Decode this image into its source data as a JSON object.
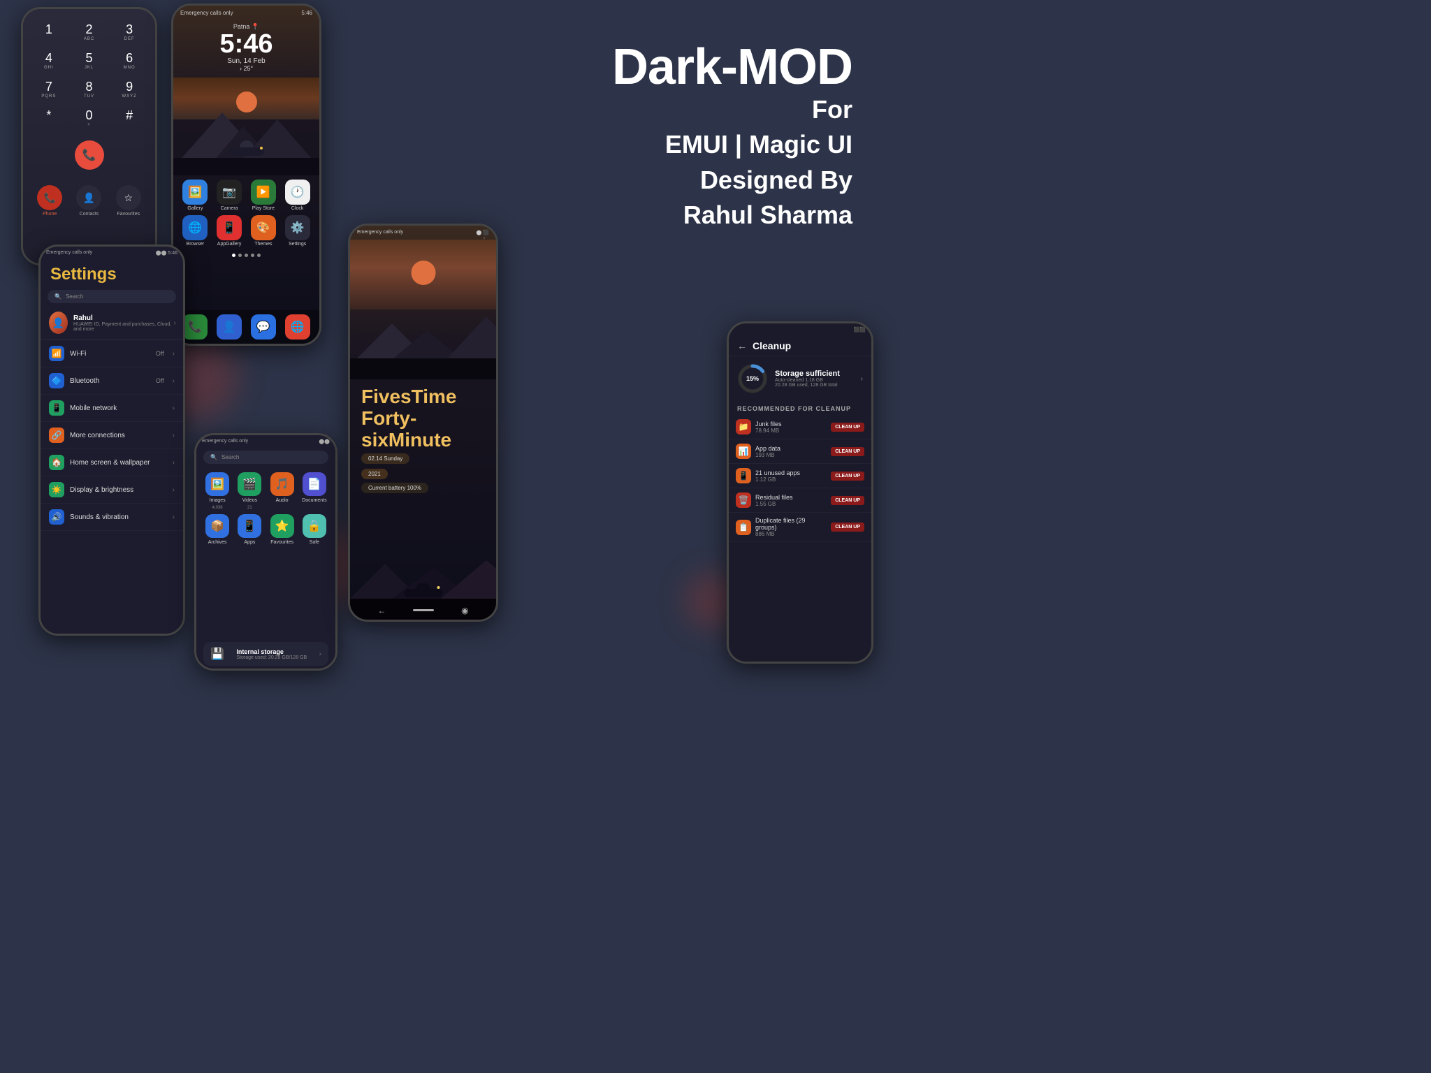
{
  "branding": {
    "title": "Dark-MOD",
    "line1": "For",
    "line2": "EMUI | Magic UI",
    "line3": "Designed By",
    "line4": "Rahul Sharma"
  },
  "phone_dialer": {
    "keys": [
      {
        "num": "1",
        "letters": ""
      },
      {
        "num": "2",
        "letters": "ABC"
      },
      {
        "num": "3",
        "letters": "DEF"
      },
      {
        "num": "4",
        "letters": "GHI"
      },
      {
        "num": "5",
        "letters": "JKL"
      },
      {
        "num": "6",
        "letters": "MNO"
      },
      {
        "num": "7",
        "letters": "PQRS"
      },
      {
        "num": "8",
        "letters": "TUV"
      },
      {
        "num": "9",
        "letters": "WXYZ"
      },
      {
        "num": "*",
        "letters": ""
      },
      {
        "num": "0",
        "letters": "+"
      },
      {
        "num": "#",
        "letters": ""
      }
    ],
    "actions": [
      "Phone",
      "Contacts",
      "Favourites"
    ]
  },
  "phone_home": {
    "status_left": "Emergency calls only",
    "status_right": "5:46",
    "city": "Patna",
    "time": "5:46",
    "date": "Sun, 14 Feb",
    "temp": "25°",
    "apps_row1": [
      {
        "name": "Gallery",
        "color": "#3080e0"
      },
      {
        "name": "Camera",
        "color": "#222"
      },
      {
        "name": "Play Store",
        "color": "#2a7a3a"
      },
      {
        "name": "Clock",
        "color": "#eee"
      }
    ],
    "apps_row2": [
      {
        "name": "Browser",
        "color": "#2060c0"
      },
      {
        "name": "AppGallery",
        "color": "#e03030"
      },
      {
        "name": "Themes",
        "color": "#e06020"
      },
      {
        "name": "Settings",
        "color": "#2a2a3a"
      }
    ],
    "dock": [
      {
        "name": "Phone",
        "color": "#2a8a3a"
      },
      {
        "name": "Contacts",
        "color": "#3060d0"
      },
      {
        "name": "Messages",
        "color": "#2a70e0"
      },
      {
        "name": "Chrome",
        "color": "#e04030"
      }
    ]
  },
  "phone_settings": {
    "title": "Settings",
    "search_placeholder": "Search",
    "profile_name": "Rahul",
    "profile_sub": "HUAWEI ID, Payment and purchases, Cloud, and more",
    "items": [
      {
        "icon": "📶",
        "label": "Wi-Fi",
        "value": "Off",
        "color": "#2060d0"
      },
      {
        "icon": "🔷",
        "label": "Bluetooth",
        "value": "Off",
        "color": "#2060d0"
      },
      {
        "icon": "📱",
        "label": "Mobile network",
        "value": "",
        "color": "#20a060"
      },
      {
        "icon": "🔗",
        "label": "More connections",
        "value": "",
        "color": "#e06020"
      },
      {
        "icon": "🏠",
        "label": "Home screen & wallpaper",
        "value": "",
        "color": "#20a060"
      },
      {
        "icon": "☀️",
        "label": "Display & brightness",
        "value": "",
        "color": "#20a060"
      },
      {
        "icon": "🔊",
        "label": "Sounds & vibration",
        "value": "",
        "color": "#2060d0"
      }
    ]
  },
  "phone_files": {
    "search_placeholder": "Search",
    "categories": [
      {
        "icon": "🖼️",
        "label": "Images",
        "count": "4,038",
        "color": "#3070e0"
      },
      {
        "icon": "🎬",
        "label": "Videos",
        "count": "21",
        "color": "#20a060"
      },
      {
        "icon": "🎵",
        "label": "Audio",
        "count": "",
        "color": "#e06020"
      },
      {
        "icon": "📄",
        "label": "Documents",
        "count": "",
        "color": "#5050d0"
      },
      {
        "icon": "📦",
        "label": "Archives",
        "count": "",
        "color": "#3070e0"
      },
      {
        "icon": "📱",
        "label": "Apps",
        "count": "",
        "color": "#3070e0"
      },
      {
        "icon": "⭐",
        "label": "Favourites",
        "count": "",
        "color": "#20a060"
      },
      {
        "icon": "🔒",
        "label": "Safe",
        "count": "",
        "color": "#50c0b0"
      }
    ],
    "storage_title": "Internal storage",
    "storage_sub": "Storage used: 20.28 GB/128 GB"
  },
  "phone_clock": {
    "status_left": "Emergency calls only",
    "big_text1": "FivesTime",
    "big_text2": "Forty-sixMinute",
    "date_line": "02.14 Sunday",
    "year": "2021",
    "battery": "Current battery 100%"
  },
  "phone_cleanup": {
    "title": "Cleanup",
    "storage_percent": "15%",
    "storage_main": "Storage sufficient",
    "storage_sub": "Auto-cleaned 1.18 GB\n20.28 GB used, 128 GB total",
    "section_title": "RECOMMENDED FOR CLEANUP",
    "items": [
      {
        "icon": "📁",
        "name": "Junk files",
        "size": "78.94 MB",
        "color": "#c03020"
      },
      {
        "icon": "📊",
        "name": "App data",
        "size": "193 MB",
        "color": "#e06020"
      },
      {
        "icon": "📱",
        "name": "21 unused apps",
        "size": "1.12 GB",
        "color": "#e06020"
      },
      {
        "icon": "🗑️",
        "name": "Residual files",
        "size": "1.55 GB",
        "color": "#c03020"
      },
      {
        "icon": "📋",
        "name": "Duplicate files (29 groups)",
        "size": "886 MB",
        "color": "#e06020"
      }
    ],
    "clean_up_label": "CLEAN UP"
  }
}
